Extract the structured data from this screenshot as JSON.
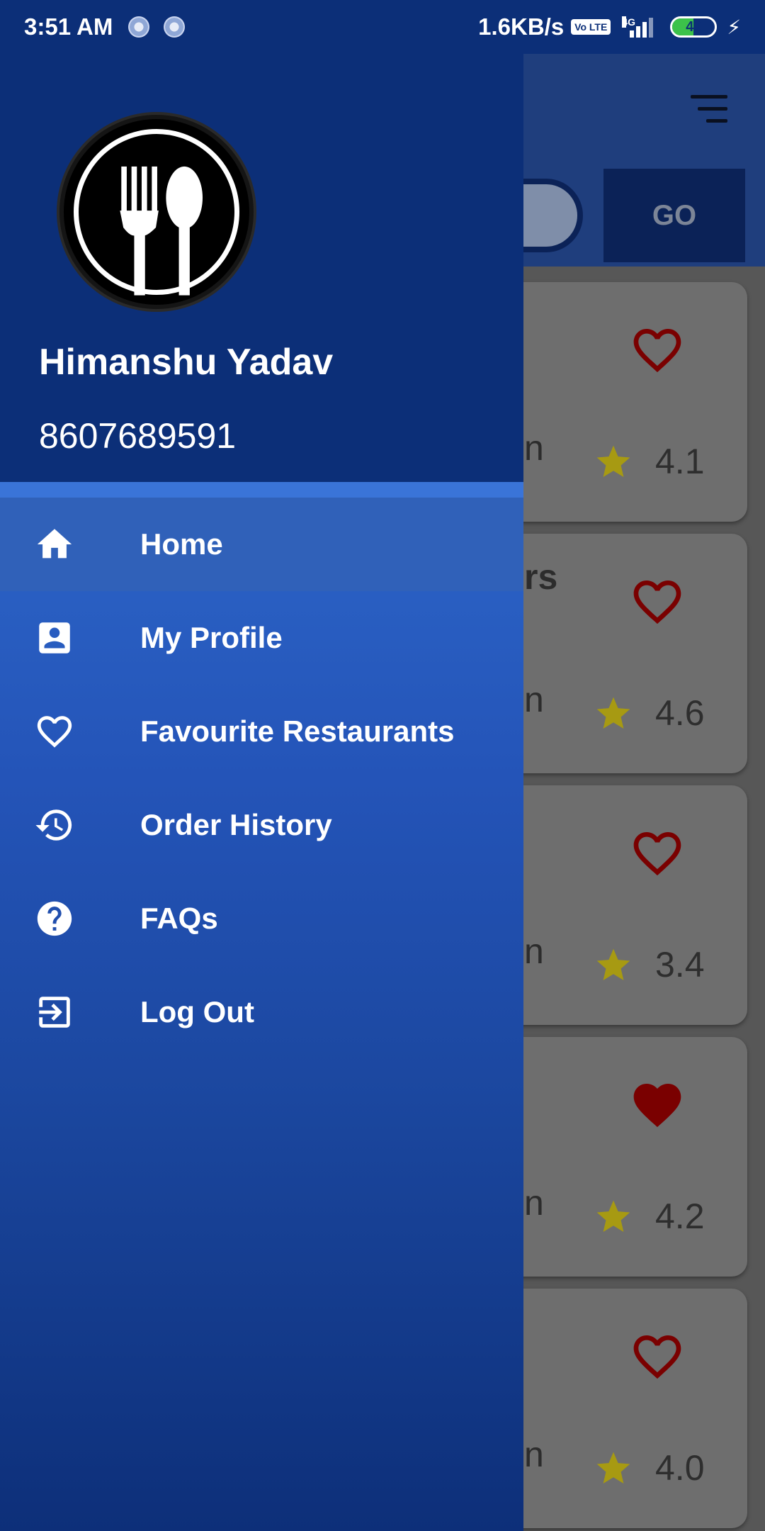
{
  "status_bar": {
    "time": "3:51 AM",
    "net_speed": "1.6KB/s",
    "volte": "Vo LTE",
    "network": "4G",
    "battery": "49",
    "battery_level": 0.49
  },
  "drawer": {
    "user_name": "Himanshu Yadav",
    "phone": "8607689591",
    "avatar_icon": "fork-spoon-logo",
    "items": [
      {
        "label": "Home",
        "icon": "home-icon",
        "active": true
      },
      {
        "label": "My Profile",
        "icon": "profile-icon",
        "active": false
      },
      {
        "label": "Favourite Restaurants",
        "icon": "heart-outline-icon",
        "active": false
      },
      {
        "label": "Order History",
        "icon": "history-icon",
        "active": false
      },
      {
        "label": "FAQs",
        "icon": "help-icon",
        "active": false
      },
      {
        "label": "Log Out",
        "icon": "logout-icon",
        "active": false
      }
    ]
  },
  "background_app": {
    "go_label": "GO",
    "cards": [
      {
        "name_fragment": "",
        "fragment": "n",
        "rating": "4.1",
        "favourite": false
      },
      {
        "name_fragment": "rs",
        "fragment": "n",
        "rating": "4.6",
        "favourite": false
      },
      {
        "name_fragment": "",
        "fragment": "n",
        "rating": "3.4",
        "favourite": false
      },
      {
        "name_fragment": "",
        "fragment": "n",
        "rating": "4.2",
        "favourite": true
      },
      {
        "name_fragment": "",
        "fragment": "n",
        "rating": "4.0",
        "favourite": false
      }
    ]
  },
  "colors": {
    "primary_dark": "#0c2f78",
    "drawer_blue": "#2c64c7",
    "heart_red": "#7a0000",
    "star_yellow": "#a79a12"
  }
}
